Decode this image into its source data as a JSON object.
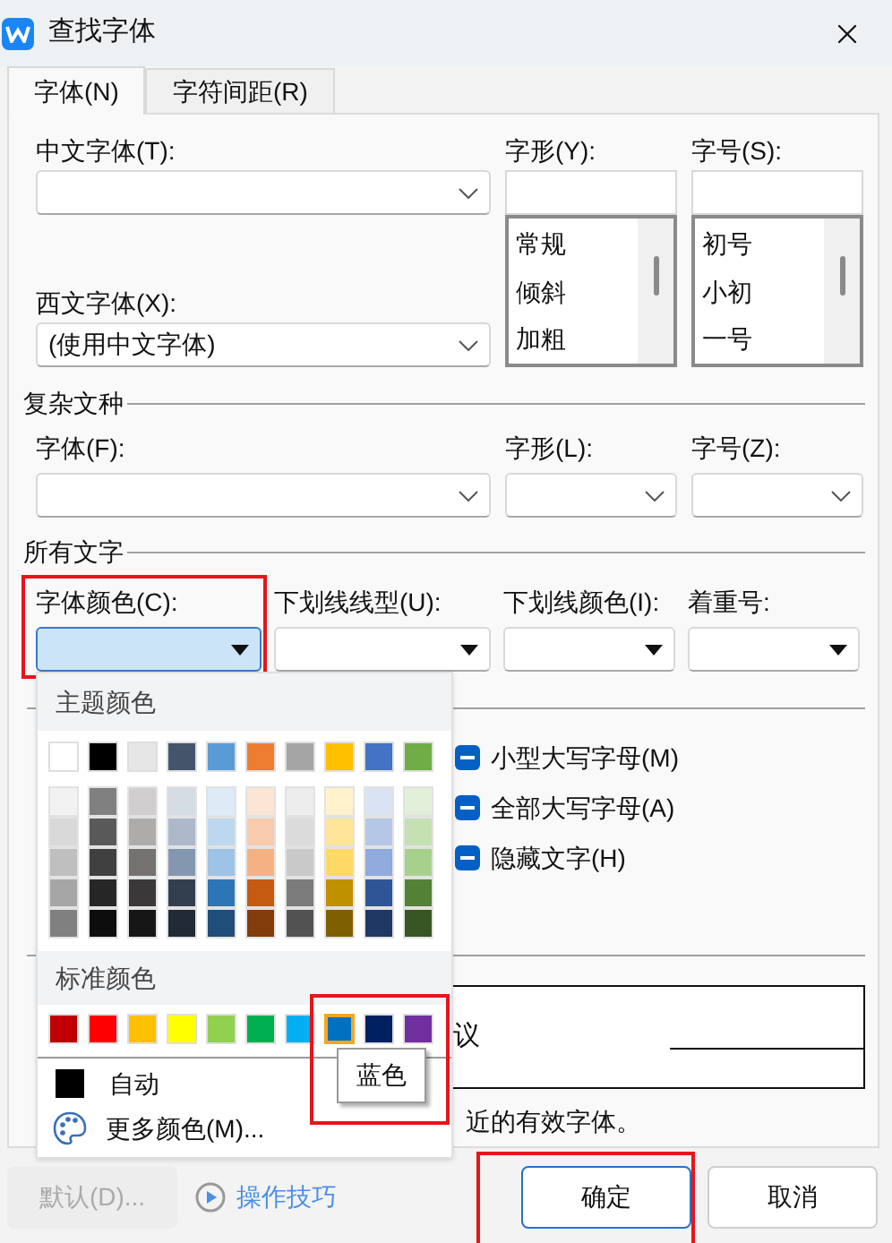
{
  "window": {
    "title": "查找字体"
  },
  "tabs": [
    {
      "label": "字体(N)",
      "selected": true
    },
    {
      "label": "字符间距(R)",
      "selected": false
    }
  ],
  "chinese_font": {
    "label": "中文字体(T):"
  },
  "font_style": {
    "label": "字形(Y):",
    "options": [
      {
        "label": "常规",
        "selected": false
      },
      {
        "label": "倾斜",
        "selected": false
      },
      {
        "label": "加粗",
        "selected": false
      }
    ]
  },
  "font_size": {
    "label": "字号(S):",
    "options": [
      {
        "label": "初号",
        "selected": false
      },
      {
        "label": "小初",
        "selected": false
      },
      {
        "label": "一号",
        "selected": false
      }
    ]
  },
  "western_font": {
    "label": "西文字体(X):",
    "value": "(使用中文字体)"
  },
  "complex_script": {
    "title": "复杂文种",
    "fields": [
      {
        "label": "字体(F):"
      },
      {
        "label": "字形(L):"
      },
      {
        "label": "字号(Z):"
      }
    ]
  },
  "all_text": {
    "title": "所有文字",
    "fields": [
      {
        "label": "字体颜色(C):",
        "selected": true,
        "highlighted": true
      },
      {
        "label": "下划线线型(U):",
        "selected": false,
        "highlighted": false
      },
      {
        "label": "下划线颜色(I):",
        "selected": false,
        "highlighted": false
      },
      {
        "label": "着重号:",
        "selected": false,
        "highlighted": false
      }
    ]
  },
  "effects": {
    "options": [
      {
        "label": "小型大写字母(M)",
        "indeterminate": true
      },
      {
        "label": "全部大写字母(A)",
        "indeterminate": true
      },
      {
        "label": "隐藏文字(H)",
        "indeterminate": true
      }
    ]
  },
  "preview": {
    "sample": "议"
  },
  "note": "近的有效字体。",
  "buttons": [
    {
      "label": "默认(D)...",
      "kind": "button",
      "disabled": true,
      "default": false,
      "highlighted": false
    },
    {
      "label": "操作技巧",
      "kind": "link"
    },
    {
      "label": "确定",
      "kind": "button",
      "disabled": false,
      "default": true,
      "highlighted": true
    },
    {
      "label": "取消",
      "kind": "button",
      "disabled": false,
      "default": false,
      "highlighted": false
    }
  ],
  "color_popup": {
    "theme_title": "主题颜色",
    "theme_colors": [
      {
        "color": "#ffffff",
        "shades": [
          {
            "color": "#f2f2f2"
          },
          {
            "color": "#d9d9d9"
          },
          {
            "color": "#bfbfbf"
          },
          {
            "color": "#a6a6a6"
          },
          {
            "color": "#808080"
          }
        ]
      },
      {
        "color": "#000000",
        "shades": [
          {
            "color": "#808080"
          },
          {
            "color": "#595959"
          },
          {
            "color": "#404040"
          },
          {
            "color": "#262626"
          },
          {
            "color": "#0d0d0d"
          }
        ]
      },
      {
        "color": "#e7e6e6",
        "shades": [
          {
            "color": "#d0cece"
          },
          {
            "color": "#aeabab"
          },
          {
            "color": "#757171"
          },
          {
            "color": "#3a3838"
          },
          {
            "color": "#171616"
          }
        ]
      },
      {
        "color": "#44546a",
        "shades": [
          {
            "color": "#d6dce4"
          },
          {
            "color": "#adb9ca"
          },
          {
            "color": "#8497b0"
          },
          {
            "color": "#333f4f"
          },
          {
            "color": "#222a35"
          }
        ]
      },
      {
        "color": "#5b9bd5",
        "shades": [
          {
            "color": "#deebf6"
          },
          {
            "color": "#bdd7ee"
          },
          {
            "color": "#9dc3e6"
          },
          {
            "color": "#2e75b5"
          },
          {
            "color": "#1e4e79"
          }
        ]
      },
      {
        "color": "#ed7d31",
        "shades": [
          {
            "color": "#fbe5d5"
          },
          {
            "color": "#f8cbad"
          },
          {
            "color": "#f4b183"
          },
          {
            "color": "#c55a11"
          },
          {
            "color": "#833c0b"
          }
        ]
      },
      {
        "color": "#a5a5a5",
        "shades": [
          {
            "color": "#ededed"
          },
          {
            "color": "#dbdbdb"
          },
          {
            "color": "#c9c9c9"
          },
          {
            "color": "#7b7b7b"
          },
          {
            "color": "#525252"
          }
        ]
      },
      {
        "color": "#ffc000",
        "shades": [
          {
            "color": "#fff2cc"
          },
          {
            "color": "#fee599"
          },
          {
            "color": "#ffd965"
          },
          {
            "color": "#bf9000"
          },
          {
            "color": "#7f6000"
          }
        ]
      },
      {
        "color": "#4472c4",
        "shades": [
          {
            "color": "#dae3f3"
          },
          {
            "color": "#b4c7e7"
          },
          {
            "color": "#8faadc"
          },
          {
            "color": "#2f5597"
          },
          {
            "color": "#1f3864"
          }
        ]
      },
      {
        "color": "#70ad47",
        "shades": [
          {
            "color": "#e2efd9"
          },
          {
            "color": "#c5e0b3"
          },
          {
            "color": "#a8d08d"
          },
          {
            "color": "#538135"
          },
          {
            "color": "#375623"
          }
        ]
      }
    ],
    "standard_title": "标准颜色",
    "standard_colors": [
      {
        "color": "#c00000",
        "selected": false
      },
      {
        "color": "#ff0000",
        "selected": false
      },
      {
        "color": "#ffc000",
        "selected": false
      },
      {
        "color": "#ffff00",
        "selected": false
      },
      {
        "color": "#92d050",
        "selected": false
      },
      {
        "color": "#00b050",
        "selected": false
      },
      {
        "color": "#00b0f0",
        "selected": false
      },
      {
        "color": "#0070c0",
        "selected": true
      },
      {
        "color": "#002060",
        "selected": false
      },
      {
        "color": "#7030a0",
        "selected": false
      }
    ],
    "tooltip": {
      "label": "蓝色",
      "highlighted": true
    },
    "auto": {
      "label": "自动",
      "color": "#000000"
    },
    "more": {
      "label": "更多颜色(M)..."
    }
  }
}
